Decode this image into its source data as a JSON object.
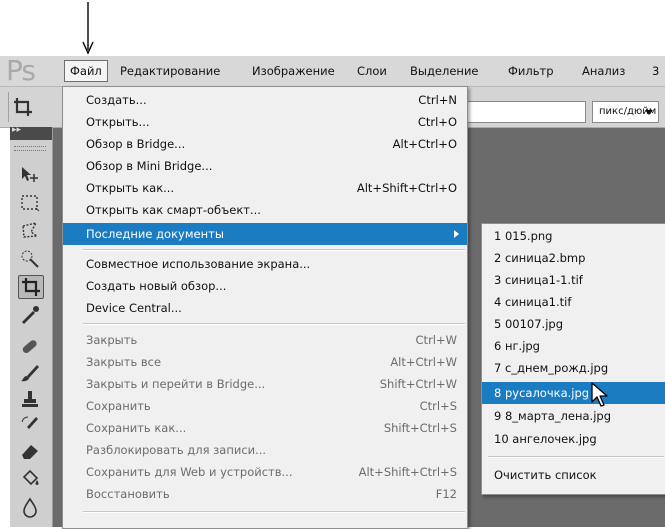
{
  "app": {
    "logo": "Ps"
  },
  "menubar": {
    "items": [
      "Файл",
      "Редактирование",
      "Изображение",
      "Слои",
      "Выделение",
      "Фильтр",
      "Анализ",
      "3"
    ]
  },
  "options": {
    "units_value": "пикс/дюйм"
  },
  "file_menu": {
    "items": [
      {
        "label": "Создать...",
        "shortcut": "Ctrl+N"
      },
      {
        "label": "Открыть...",
        "shortcut": "Ctrl+O"
      },
      {
        "label": "Обзор в Bridge...",
        "shortcut": "Alt+Ctrl+O"
      },
      {
        "label": "Обзор в Mini Bridge...",
        "shortcut": ""
      },
      {
        "label": "Открыть как...",
        "shortcut": "Alt+Shift+Ctrl+O"
      },
      {
        "label": "Открыть как смарт-объект...",
        "shortcut": ""
      },
      {
        "label": "Последние документы",
        "shortcut": ""
      },
      {
        "label": "Совместное использование экрана...",
        "shortcut": ""
      },
      {
        "label": "Создать новый обзор...",
        "shortcut": ""
      },
      {
        "label": "Device Central...",
        "shortcut": ""
      },
      {
        "label": "Закрыть",
        "shortcut": "Ctrl+W"
      },
      {
        "label": "Закрыть все",
        "shortcut": "Alt+Ctrl+W"
      },
      {
        "label": "Закрыть и перейти в Bridge...",
        "shortcut": "Shift+Ctrl+W"
      },
      {
        "label": "Сохранить",
        "shortcut": "Ctrl+S"
      },
      {
        "label": "Сохранить как...",
        "shortcut": "Shift+Ctrl+S"
      },
      {
        "label": "Разблокировать для записи...",
        "shortcut": ""
      },
      {
        "label": "Сохранить для Web и устройств...",
        "shortcut": "Alt+Shift+Ctrl+S"
      },
      {
        "label": "Восстановить",
        "shortcut": "F12"
      }
    ]
  },
  "recent_menu": {
    "items": [
      "1 015.png",
      "2 синица2.bmp",
      "3 синица1-1.tif",
      "4 синица1.tif",
      "5 00107.jpg",
      "6 нг.jpg",
      "7 с_днем_рожд.jpg",
      "8 русалочка.jpg",
      "9 8_марта_лена.jpg",
      "10 ангелочек.jpg"
    ],
    "clear": "Очистить список"
  },
  "colors": {
    "highlight": "#1b7cc1",
    "menu_bg": "#f0f0f0",
    "canvas": "#6b6b6b"
  }
}
